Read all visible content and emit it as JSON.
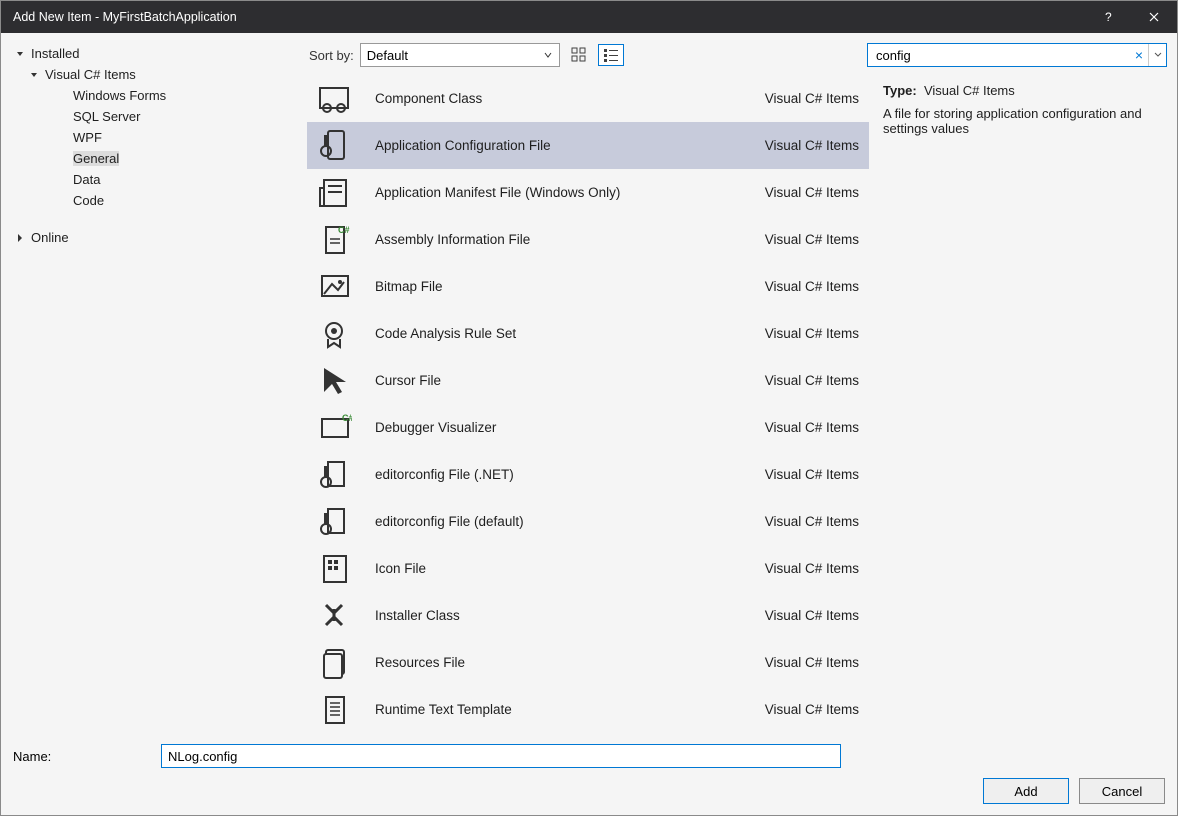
{
  "window": {
    "title": "Add New Item - MyFirstBatchApplication"
  },
  "tree": {
    "installed": "Installed",
    "visual_csharp_items": "Visual C# Items",
    "children": [
      "Windows Forms",
      "SQL Server",
      "WPF",
      "General",
      "Data",
      "Code"
    ],
    "selected_child_index": 3,
    "online": "Online"
  },
  "toolbar": {
    "sort_label": "Sort by:",
    "sort_value": "Default",
    "search_value": "config"
  },
  "items": [
    {
      "name": "Component Class",
      "lang": "Visual C# Items",
      "icon": "component"
    },
    {
      "name": "Application Configuration File",
      "lang": "Visual C# Items",
      "icon": "config",
      "selected": true
    },
    {
      "name": "Application Manifest File (Windows Only)",
      "lang": "Visual C# Items",
      "icon": "manifest"
    },
    {
      "name": "Assembly Information File",
      "lang": "Visual C# Items",
      "icon": "assemblyinfo"
    },
    {
      "name": "Bitmap File",
      "lang": "Visual C# Items",
      "icon": "bitmap"
    },
    {
      "name": "Code Analysis Rule Set",
      "lang": "Visual C# Items",
      "icon": "ruleset"
    },
    {
      "name": "Cursor File",
      "lang": "Visual C# Items",
      "icon": "cursor"
    },
    {
      "name": "Debugger Visualizer",
      "lang": "Visual C# Items",
      "icon": "visualizer"
    },
    {
      "name": "editorconfig File (.NET)",
      "lang": "Visual C# Items",
      "icon": "editorconfig"
    },
    {
      "name": "editorconfig File (default)",
      "lang": "Visual C# Items",
      "icon": "editorconfig"
    },
    {
      "name": "Icon File",
      "lang": "Visual C# Items",
      "icon": "iconfile"
    },
    {
      "name": "Installer Class",
      "lang": "Visual C# Items",
      "icon": "installer"
    },
    {
      "name": "Resources File",
      "lang": "Visual C# Items",
      "icon": "resources"
    },
    {
      "name": "Runtime Text Template",
      "lang": "Visual C# Items",
      "icon": "texttemplate"
    }
  ],
  "info": {
    "type_label": "Type:",
    "type_value": "Visual C# Items",
    "description": "A file for storing application configuration and settings values"
  },
  "name_bar": {
    "label": "Name:",
    "value": "NLog.config"
  },
  "footer": {
    "add": "Add",
    "cancel": "Cancel"
  }
}
